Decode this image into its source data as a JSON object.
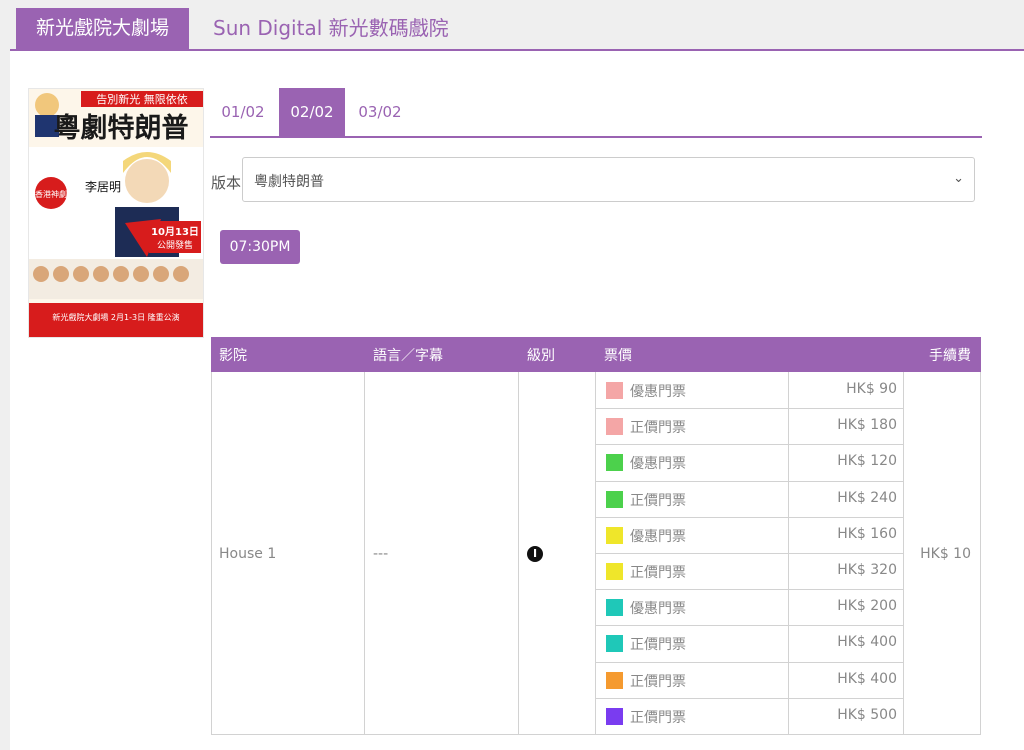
{
  "venue_tabs": {
    "active": "新光戲院大劇場",
    "other": "Sun Digital 新光數碼戲院"
  },
  "poster": {
    "title": "粵劇特朗普",
    "banner": "告別新光 無限依依",
    "subtitle": "香港神劇",
    "actor": "李居明",
    "date_badge": "10月13日",
    "date_badge_sub": "公開發售",
    "footer": "新光戲院大劇場 2月1-3日 隆重公演"
  },
  "dates": [
    "01/02",
    "02/02",
    "03/02"
  ],
  "active_date_index": 1,
  "version": {
    "label": "版本",
    "value": "粵劇特朗普"
  },
  "showtime": "07:30PM",
  "table": {
    "headers": [
      "影院",
      "語言／字幕",
      "級別",
      "票價",
      "手續費"
    ],
    "house": "House 1",
    "language": "---",
    "rating": "I",
    "fee": "HK$ 10",
    "prices": [
      {
        "type": "優惠門票",
        "price": "HK$ 90",
        "color": "#f4a6a6"
      },
      {
        "type": "正價門票",
        "price": "HK$ 180",
        "color": "#f4a6a6"
      },
      {
        "type": "優惠門票",
        "price": "HK$ 120",
        "color": "#4cd14c"
      },
      {
        "type": "正價門票",
        "price": "HK$ 240",
        "color": "#4cd14c"
      },
      {
        "type": "優惠門票",
        "price": "HK$ 160",
        "color": "#efe62a"
      },
      {
        "type": "正價門票",
        "price": "HK$ 320",
        "color": "#efe62a"
      },
      {
        "type": "優惠門票",
        "price": "HK$ 200",
        "color": "#1fc8b8"
      },
      {
        "type": "正價門票",
        "price": "HK$ 400",
        "color": "#1fc8b8"
      },
      {
        "type": "正價門票",
        "price": "HK$ 400",
        "color": "#f59a2f"
      },
      {
        "type": "正價門票",
        "price": "HK$ 500",
        "color": "#7a3cf0"
      }
    ]
  },
  "colors": {
    "accent": "#9a63b2",
    "border": "#d2d2d2"
  }
}
